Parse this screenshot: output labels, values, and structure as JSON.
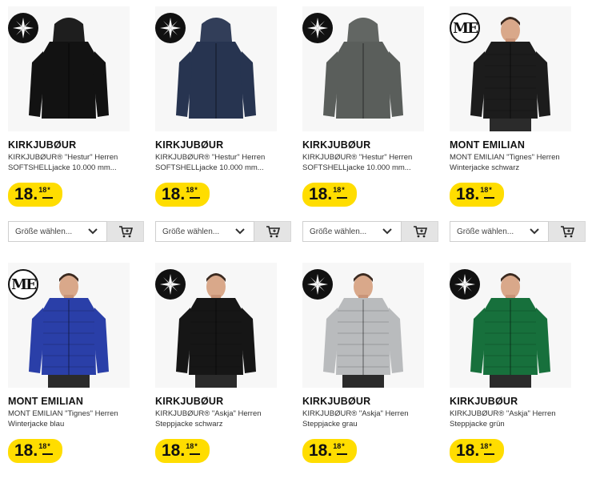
{
  "products": [
    {
      "brand": "KIRKJUBØUR",
      "line1": "KIRKJUBØUR® \"Hestur\" Herren",
      "line2": "SOFTSHELLjacke 10.000 mm...",
      "price_main": "18.",
      "price_cents": "18",
      "price_star": "*",
      "size_placeholder": "Größe wählen...",
      "logo": "compass-logo",
      "jacket_color": "#121212",
      "model": false
    },
    {
      "brand": "KIRKJUBØUR",
      "line1": "KIRKJUBØUR® \"Hestur\" Herren",
      "line2": "SOFTSHELLjacke 10.000 mm...",
      "price_main": "18.",
      "price_cents": "18",
      "price_star": "*",
      "size_placeholder": "Größe wählen...",
      "logo": "compass-logo",
      "jacket_color": "#273450",
      "model": false
    },
    {
      "brand": "KIRKJUBØUR",
      "line1": "KIRKJUBØUR® \"Hestur\" Herren",
      "line2": "SOFTSHELLjacke 10.000 mm...",
      "price_main": "18.",
      "price_cents": "18",
      "price_star": "*",
      "size_placeholder": "Größe wählen...",
      "logo": "compass-logo",
      "jacket_color": "#5a5e5b",
      "model": false
    },
    {
      "brand": "MONT EMILIAN",
      "line1": "MONT EMILIAN \"Tignes\" Herren",
      "line2": "Winterjacke schwarz",
      "price_main": "18.",
      "price_cents": "18",
      "price_star": "*",
      "size_placeholder": "Größe wählen...",
      "logo": "me-logo",
      "jacket_color": "#1c1c1c",
      "model": true
    },
    {
      "brand": "MONT EMILIAN",
      "line1": "MONT EMILIAN \"Tignes\" Herren",
      "line2": "Winterjacke blau",
      "price_main": "18.",
      "price_cents": "18",
      "price_star": "*",
      "logo": "me-logo",
      "jacket_color": "#2a3fa8",
      "model": true
    },
    {
      "brand": "KIRKJUBØUR",
      "line1": "KIRKJUBØUR® \"Askja\" Herren",
      "line2": "Steppjacke schwarz",
      "price_main": "18.",
      "price_cents": "18",
      "price_star": "*",
      "logo": "compass-logo",
      "jacket_color": "#161616",
      "model": true
    },
    {
      "brand": "KIRKJUBØUR",
      "line1": "KIRKJUBØUR® \"Askja\" Herren",
      "line2": "Steppjacke grau",
      "price_main": "18.",
      "price_cents": "18",
      "price_star": "*",
      "logo": "compass-logo",
      "jacket_color": "#b9bbbd",
      "model": true
    },
    {
      "brand": "KIRKJUBØUR",
      "line1": "KIRKJUBØUR® \"Askja\" Herren",
      "line2": "Steppjacke grün",
      "price_main": "18.",
      "price_cents": "18",
      "price_star": "*",
      "logo": "compass-logo",
      "jacket_color": "#17703c",
      "model": true
    }
  ],
  "colors": {
    "price_badge": "#ffdd00",
    "cart_button": "#e4e4e4"
  },
  "icons": {
    "cart": "cart-icon",
    "chevron": "chevron-down-icon"
  }
}
